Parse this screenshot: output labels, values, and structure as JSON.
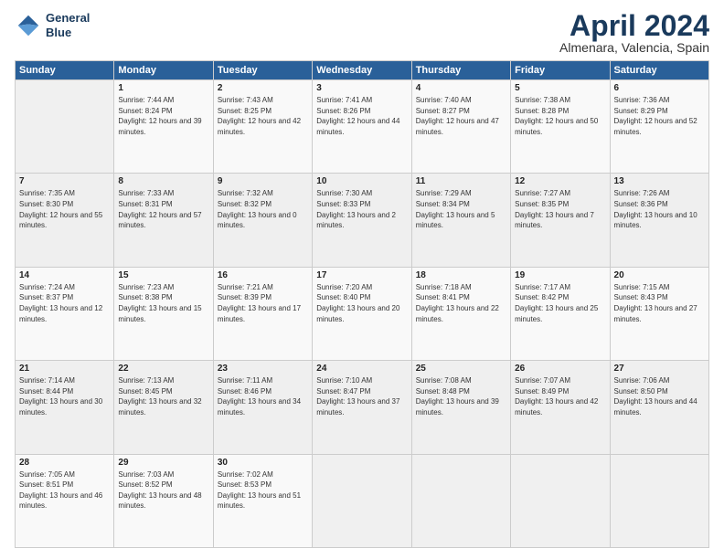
{
  "header": {
    "logo_line1": "General",
    "logo_line2": "Blue",
    "month_title": "April 2024",
    "subtitle": "Almenara, Valencia, Spain"
  },
  "days_of_week": [
    "Sunday",
    "Monday",
    "Tuesday",
    "Wednesday",
    "Thursday",
    "Friday",
    "Saturday"
  ],
  "weeks": [
    [
      {
        "day": "",
        "sunrise": "",
        "sunset": "",
        "daylight": ""
      },
      {
        "day": "1",
        "sunrise": "Sunrise: 7:44 AM",
        "sunset": "Sunset: 8:24 PM",
        "daylight": "Daylight: 12 hours and 39 minutes."
      },
      {
        "day": "2",
        "sunrise": "Sunrise: 7:43 AM",
        "sunset": "Sunset: 8:25 PM",
        "daylight": "Daylight: 12 hours and 42 minutes."
      },
      {
        "day": "3",
        "sunrise": "Sunrise: 7:41 AM",
        "sunset": "Sunset: 8:26 PM",
        "daylight": "Daylight: 12 hours and 44 minutes."
      },
      {
        "day": "4",
        "sunrise": "Sunrise: 7:40 AM",
        "sunset": "Sunset: 8:27 PM",
        "daylight": "Daylight: 12 hours and 47 minutes."
      },
      {
        "day": "5",
        "sunrise": "Sunrise: 7:38 AM",
        "sunset": "Sunset: 8:28 PM",
        "daylight": "Daylight: 12 hours and 50 minutes."
      },
      {
        "day": "6",
        "sunrise": "Sunrise: 7:36 AM",
        "sunset": "Sunset: 8:29 PM",
        "daylight": "Daylight: 12 hours and 52 minutes."
      }
    ],
    [
      {
        "day": "7",
        "sunrise": "Sunrise: 7:35 AM",
        "sunset": "Sunset: 8:30 PM",
        "daylight": "Daylight: 12 hours and 55 minutes."
      },
      {
        "day": "8",
        "sunrise": "Sunrise: 7:33 AM",
        "sunset": "Sunset: 8:31 PM",
        "daylight": "Daylight: 12 hours and 57 minutes."
      },
      {
        "day": "9",
        "sunrise": "Sunrise: 7:32 AM",
        "sunset": "Sunset: 8:32 PM",
        "daylight": "Daylight: 13 hours and 0 minutes."
      },
      {
        "day": "10",
        "sunrise": "Sunrise: 7:30 AM",
        "sunset": "Sunset: 8:33 PM",
        "daylight": "Daylight: 13 hours and 2 minutes."
      },
      {
        "day": "11",
        "sunrise": "Sunrise: 7:29 AM",
        "sunset": "Sunset: 8:34 PM",
        "daylight": "Daylight: 13 hours and 5 minutes."
      },
      {
        "day": "12",
        "sunrise": "Sunrise: 7:27 AM",
        "sunset": "Sunset: 8:35 PM",
        "daylight": "Daylight: 13 hours and 7 minutes."
      },
      {
        "day": "13",
        "sunrise": "Sunrise: 7:26 AM",
        "sunset": "Sunset: 8:36 PM",
        "daylight": "Daylight: 13 hours and 10 minutes."
      }
    ],
    [
      {
        "day": "14",
        "sunrise": "Sunrise: 7:24 AM",
        "sunset": "Sunset: 8:37 PM",
        "daylight": "Daylight: 13 hours and 12 minutes."
      },
      {
        "day": "15",
        "sunrise": "Sunrise: 7:23 AM",
        "sunset": "Sunset: 8:38 PM",
        "daylight": "Daylight: 13 hours and 15 minutes."
      },
      {
        "day": "16",
        "sunrise": "Sunrise: 7:21 AM",
        "sunset": "Sunset: 8:39 PM",
        "daylight": "Daylight: 13 hours and 17 minutes."
      },
      {
        "day": "17",
        "sunrise": "Sunrise: 7:20 AM",
        "sunset": "Sunset: 8:40 PM",
        "daylight": "Daylight: 13 hours and 20 minutes."
      },
      {
        "day": "18",
        "sunrise": "Sunrise: 7:18 AM",
        "sunset": "Sunset: 8:41 PM",
        "daylight": "Daylight: 13 hours and 22 minutes."
      },
      {
        "day": "19",
        "sunrise": "Sunrise: 7:17 AM",
        "sunset": "Sunset: 8:42 PM",
        "daylight": "Daylight: 13 hours and 25 minutes."
      },
      {
        "day": "20",
        "sunrise": "Sunrise: 7:15 AM",
        "sunset": "Sunset: 8:43 PM",
        "daylight": "Daylight: 13 hours and 27 minutes."
      }
    ],
    [
      {
        "day": "21",
        "sunrise": "Sunrise: 7:14 AM",
        "sunset": "Sunset: 8:44 PM",
        "daylight": "Daylight: 13 hours and 30 minutes."
      },
      {
        "day": "22",
        "sunrise": "Sunrise: 7:13 AM",
        "sunset": "Sunset: 8:45 PM",
        "daylight": "Daylight: 13 hours and 32 minutes."
      },
      {
        "day": "23",
        "sunrise": "Sunrise: 7:11 AM",
        "sunset": "Sunset: 8:46 PM",
        "daylight": "Daylight: 13 hours and 34 minutes."
      },
      {
        "day": "24",
        "sunrise": "Sunrise: 7:10 AM",
        "sunset": "Sunset: 8:47 PM",
        "daylight": "Daylight: 13 hours and 37 minutes."
      },
      {
        "day": "25",
        "sunrise": "Sunrise: 7:08 AM",
        "sunset": "Sunset: 8:48 PM",
        "daylight": "Daylight: 13 hours and 39 minutes."
      },
      {
        "day": "26",
        "sunrise": "Sunrise: 7:07 AM",
        "sunset": "Sunset: 8:49 PM",
        "daylight": "Daylight: 13 hours and 42 minutes."
      },
      {
        "day": "27",
        "sunrise": "Sunrise: 7:06 AM",
        "sunset": "Sunset: 8:50 PM",
        "daylight": "Daylight: 13 hours and 44 minutes."
      }
    ],
    [
      {
        "day": "28",
        "sunrise": "Sunrise: 7:05 AM",
        "sunset": "Sunset: 8:51 PM",
        "daylight": "Daylight: 13 hours and 46 minutes."
      },
      {
        "day": "29",
        "sunrise": "Sunrise: 7:03 AM",
        "sunset": "Sunset: 8:52 PM",
        "daylight": "Daylight: 13 hours and 48 minutes."
      },
      {
        "day": "30",
        "sunrise": "Sunrise: 7:02 AM",
        "sunset": "Sunset: 8:53 PM",
        "daylight": "Daylight: 13 hours and 51 minutes."
      },
      {
        "day": "",
        "sunrise": "",
        "sunset": "",
        "daylight": ""
      },
      {
        "day": "",
        "sunrise": "",
        "sunset": "",
        "daylight": ""
      },
      {
        "day": "",
        "sunrise": "",
        "sunset": "",
        "daylight": ""
      },
      {
        "day": "",
        "sunrise": "",
        "sunset": "",
        "daylight": ""
      }
    ]
  ]
}
